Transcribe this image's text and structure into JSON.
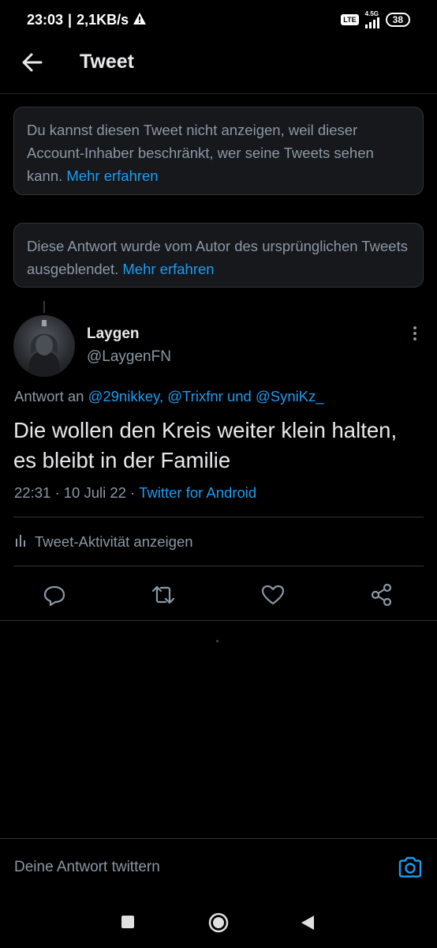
{
  "status": {
    "time": "23:03",
    "speed": "2,1KB/s",
    "volte": "Vo LTE",
    "network": "4.5G",
    "battery": "38"
  },
  "header": {
    "title": "Tweet"
  },
  "notices": [
    {
      "text": "Du kannst diesen Tweet nicht anzeigen, weil dieser Account-Inhaber beschränkt, wer seine Tweets sehen kann. ",
      "link": "Mehr erfahren"
    },
    {
      "text": "Diese Antwort wurde vom Autor des ursprünglichen Tweets ausgeblendet. ",
      "link": "Mehr erfahren"
    }
  ],
  "tweet": {
    "name": "Laygen",
    "handle": "@LaygenFN",
    "reply_prefix": "Antwort an ",
    "mention1": "@29nikkey,",
    "mention2": "@Trixfnr",
    "reply_and": "und",
    "mention3": "@SyniKz_",
    "text": "Die wollen den Kreis weiter klein halten, es bleibt in der Familie",
    "time": "22:31",
    "date": "10 Juli 22",
    "sep": "·",
    "source": "Twitter for Android",
    "activity": "Tweet-Aktivität anzeigen"
  },
  "compose": {
    "placeholder": "Deine Antwort twittern"
  },
  "colors": {
    "link": "#1d9bf0",
    "muted": "#8b98a5",
    "text": "#e7e9ea",
    "card": "#16181c"
  }
}
